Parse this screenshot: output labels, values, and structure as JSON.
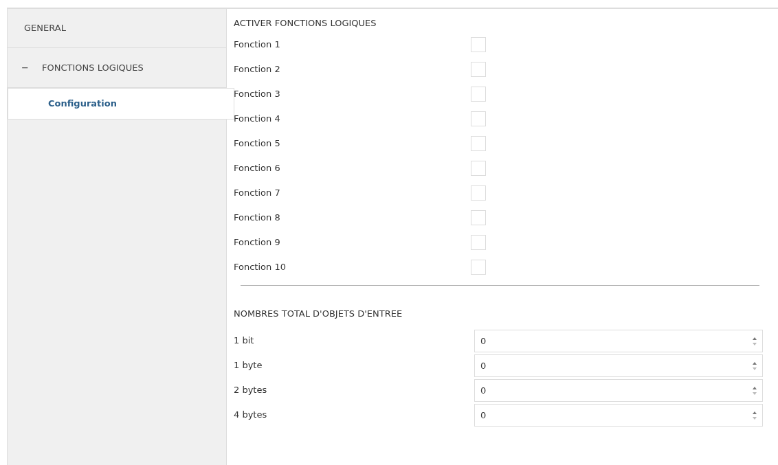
{
  "sidebar": {
    "items": [
      {
        "kind": "page",
        "label": "GENERAL",
        "selected": false
      },
      {
        "kind": "group",
        "label": "FONCTIONS LOGIQUES",
        "toggle": "−",
        "expanded": true,
        "selected": false,
        "children": [
          {
            "kind": "page",
            "label": "Configuration",
            "selected": true
          }
        ]
      }
    ]
  },
  "functions": {
    "title": "ACTIVER FONCTIONS LOGIQUES",
    "rows": [
      {
        "label": "Fonction 1",
        "checked": false
      },
      {
        "label": "Fonction 2",
        "checked": false
      },
      {
        "label": "Fonction 3",
        "checked": false
      },
      {
        "label": "Fonction 4",
        "checked": false
      },
      {
        "label": "Fonction 5",
        "checked": false
      },
      {
        "label": "Fonction 6",
        "checked": false
      },
      {
        "label": "Fonction 7",
        "checked": false
      },
      {
        "label": "Fonction 8",
        "checked": false
      },
      {
        "label": "Fonction 9",
        "checked": false
      },
      {
        "label": "Fonction 10",
        "checked": false
      }
    ]
  },
  "objects": {
    "title": "NOMBRES TOTAL D'OBJETS D'ENTREE",
    "rows": [
      {
        "label": "1 bit",
        "value": "0"
      },
      {
        "label": "1 byte",
        "value": "0"
      },
      {
        "label": "2 bytes",
        "value": "0"
      },
      {
        "label": "4 bytes",
        "value": "0"
      }
    ]
  }
}
